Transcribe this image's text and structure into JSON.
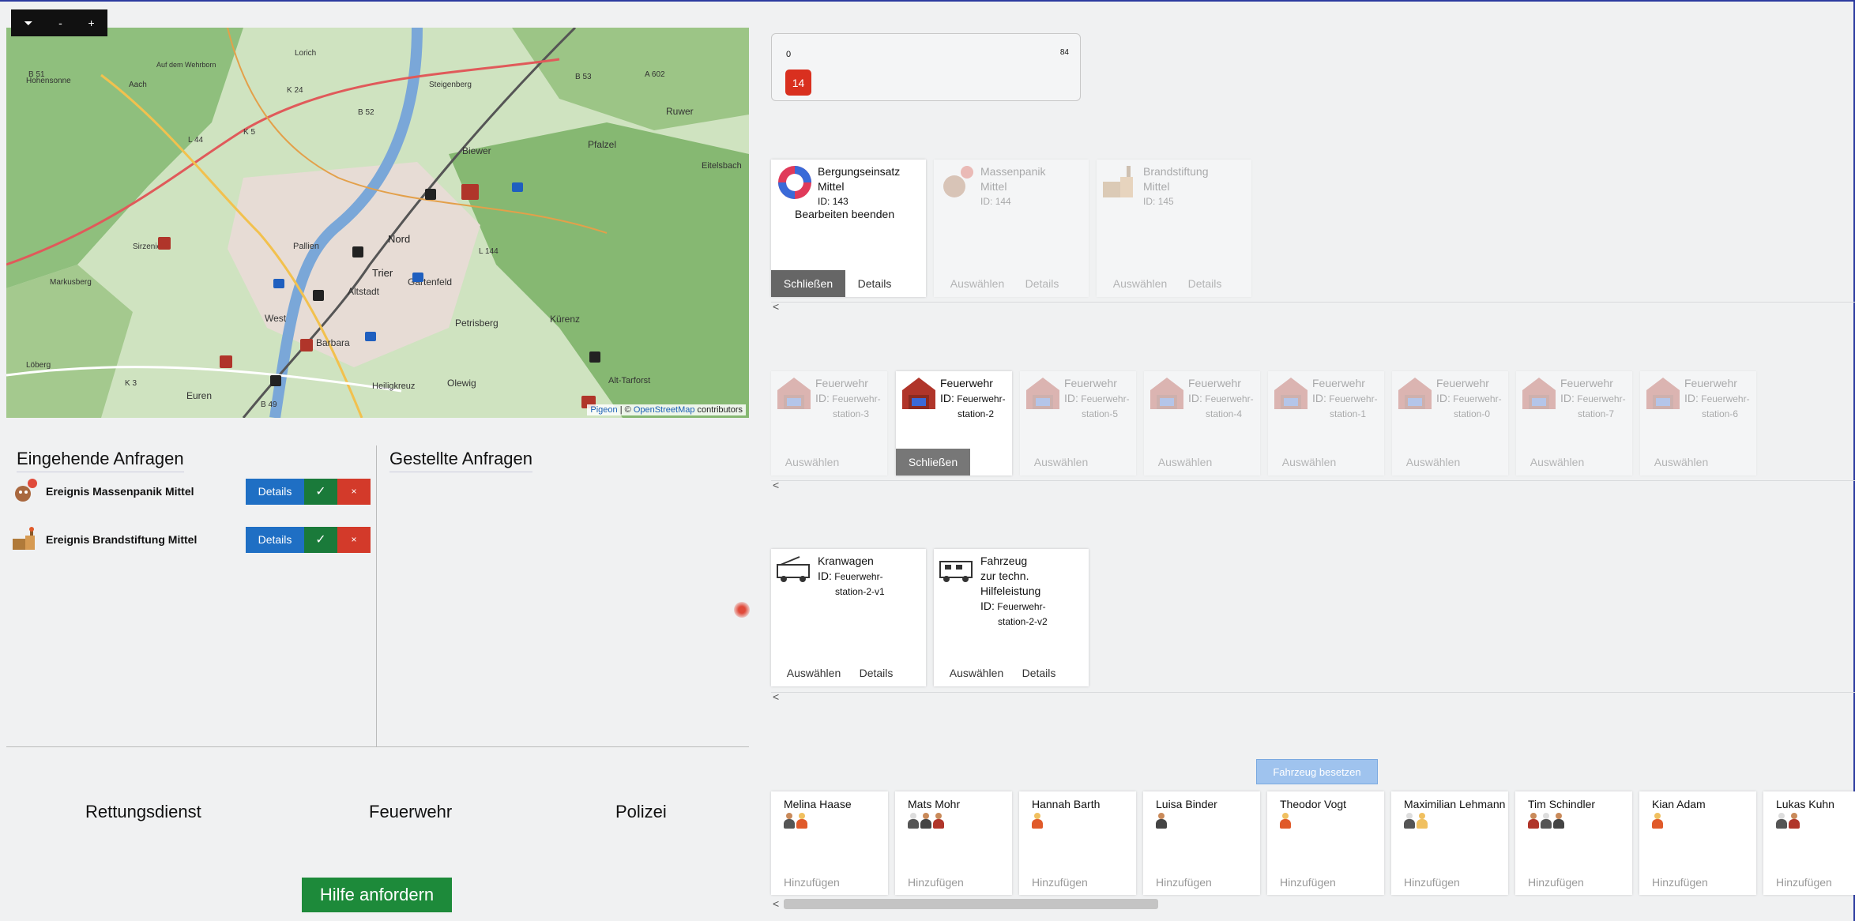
{
  "map": {
    "toolbar": [
      "⏷",
      "-",
      "+"
    ],
    "attribution_link1": "Pigeon",
    "attribution_sep": " | © ",
    "attribution_link2": "OpenStreetMap",
    "attribution_tail": " contributors",
    "place_labels": [
      "B 51",
      "Auf dem Wehrborn",
      "Lorich",
      "Hohensonne",
      "Aach",
      "K 24",
      "Steigenberg",
      "B 53",
      "A 602",
      "Ruwer",
      "B 52",
      "K 5",
      "L 44",
      "Biewer",
      "Pfalzel",
      "Eitelsbach",
      "Trier",
      "Nord",
      "Pallien",
      "L 144",
      "Altstadt",
      "Gartenfeld",
      "Petrisberg",
      "Kürenz",
      "Barbara",
      "West",
      "Olewig",
      "Heiligkreuz",
      "Alt-Tarforst",
      "Euren",
      "K 3",
      "B 49",
      "Sirzenich",
      "Markusberg",
      "Löberg"
    ]
  },
  "incoming": {
    "title": "Eingehende Anfragen",
    "items": [
      {
        "label": "Ereignis Massenpanik Mittel",
        "details": "Details",
        "accept": "✓",
        "reject": "×"
      },
      {
        "label": "Ereignis Brandstiftung Mittel",
        "details": "Details",
        "accept": "✓",
        "reject": "×"
      }
    ]
  },
  "outgoing": {
    "title": "Gestellte Anfragen"
  },
  "services": [
    "Rettungsdienst",
    "Feuerwehr",
    "Polizei"
  ],
  "help_button": "Hilfe anfordern",
  "counter": {
    "min": "0",
    "max": "84",
    "value": "14"
  },
  "events": [
    {
      "name": "Bergungseinsatz",
      "level": "Mittel",
      "id_label": "ID:",
      "id": "143",
      "extra": "Bearbeiten beenden",
      "primary": "Schließen",
      "secondary": "Details",
      "active": true
    },
    {
      "name": "Massenpanik",
      "level": "Mittel",
      "id_label": "ID:",
      "id": "144",
      "primary": "Auswählen",
      "secondary": "Details",
      "active": false
    },
    {
      "name": "Brandstiftung",
      "level": "Mittel",
      "id_label": "ID:",
      "id": "145",
      "primary": "Auswählen",
      "secondary": "Details",
      "active": false
    }
  ],
  "stations": [
    {
      "name": "Feuerwehr",
      "id_label": "ID:",
      "id1": "Feuerwehr-",
      "id2": "station-3",
      "action": "Auswählen",
      "active": false
    },
    {
      "name": "Feuerwehr",
      "id_label": "ID:",
      "id1": "Feuerwehr-",
      "id2": "station-2",
      "action": "Schließen",
      "active": true
    },
    {
      "name": "Feuerwehr",
      "id_label": "ID:",
      "id1": "Feuerwehr-",
      "id2": "station-5",
      "action": "Auswählen",
      "active": false
    },
    {
      "name": "Feuerwehr",
      "id_label": "ID:",
      "id1": "Feuerwehr-",
      "id2": "station-4",
      "action": "Auswählen",
      "active": false
    },
    {
      "name": "Feuerwehr",
      "id_label": "ID:",
      "id1": "Feuerwehr-",
      "id2": "station-1",
      "action": "Auswählen",
      "active": false
    },
    {
      "name": "Feuerwehr",
      "id_label": "ID:",
      "id1": "Feuerwehr-",
      "id2": "station-0",
      "action": "Auswählen",
      "active": false
    },
    {
      "name": "Feuerwehr",
      "id_label": "ID:",
      "id1": "Feuerwehr-",
      "id2": "station-7",
      "action": "Auswählen",
      "active": false
    },
    {
      "name": "Feuerwehr",
      "id_label": "ID:",
      "id1": "Feuerwehr-",
      "id2": "station-6",
      "action": "Auswählen",
      "active": false
    }
  ],
  "vehicles": [
    {
      "name": "Kranwagen",
      "name2": "",
      "id_label": "ID:",
      "id1": "Feuerwehr-",
      "id2": "station-2-v1",
      "primary": "Auswählen",
      "secondary": "Details"
    },
    {
      "name": "Fahrzeug",
      "name2": "zur techn. Hilfeleistung",
      "id_label": "ID:",
      "id1": "Feuerwehr-",
      "id2": "station-2-v2",
      "primary": "Auswählen",
      "secondary": "Details"
    }
  ],
  "chevron": "<",
  "occupy_button": "Fahrzeug besetzen",
  "crew": [
    {
      "name": "Melina Haase",
      "add": "Hinzufügen"
    },
    {
      "name": "Mats Mohr",
      "add": "Hinzufügen"
    },
    {
      "name": "Hannah Barth",
      "add": "Hinzufügen"
    },
    {
      "name": "Luisa Binder",
      "add": "Hinzufügen"
    },
    {
      "name": "Theodor Vogt",
      "add": "Hinzufügen"
    },
    {
      "name": "Maximilian Lehmann",
      "add": "Hinzufügen"
    },
    {
      "name": "Tim Schindler",
      "add": "Hinzufügen"
    },
    {
      "name": "Kian Adam",
      "add": "Hinzufügen"
    },
    {
      "name": "Lukas Kuhn",
      "add": "Hinzufügen"
    }
  ]
}
